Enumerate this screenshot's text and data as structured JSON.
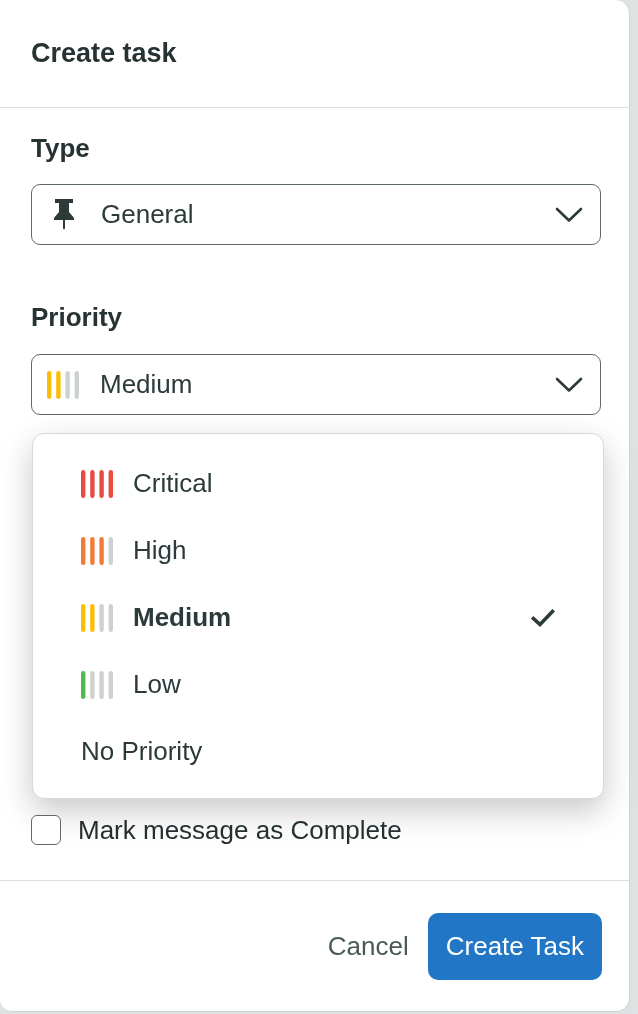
{
  "dialog": {
    "title": "Create task"
  },
  "type_field": {
    "label": "Type",
    "value": "General"
  },
  "priority_field": {
    "label": "Priority",
    "value": "Medium",
    "color": "#fbbd08",
    "level": 0.43,
    "expanded": true
  },
  "priority_menu": [
    {
      "kind": "meter",
      "label": "Critical",
      "color": "#ea4b40",
      "level": 1,
      "selected": false
    },
    {
      "kind": "meter",
      "label": "High",
      "color": "#f47b35",
      "level": 0.72,
      "selected": false
    },
    {
      "kind": "meter",
      "label": "Medium",
      "color": "#fbbd08",
      "level": 0.43,
      "selected": true
    },
    {
      "kind": "meter",
      "label": "Low",
      "color": "#4dbb4f",
      "level": 0.14,
      "selected": false
    },
    {
      "kind": "plain",
      "label": "No Priority",
      "selected": false
    }
  ],
  "checkbox": {
    "label": "Mark message as Complete",
    "checked": false
  },
  "buttons": [
    {
      "kind": "secondary",
      "label": "Cancel"
    },
    {
      "kind": "primary",
      "label": "Create Task"
    }
  ]
}
